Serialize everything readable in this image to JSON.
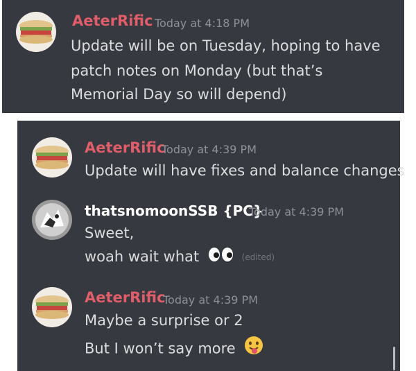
{
  "messages_top": {
    "msg1": {
      "username": "AeterRific",
      "timestamp": "Today at 4:18 PM",
      "lines": [
        "Update will be on Tuesday, hoping to have",
        "patch notes on Monday (but that’s",
        "Memorial Day so will depend)"
      ]
    }
  },
  "messages_bottom": {
    "msg2": {
      "username": "AeterRific",
      "timestamp": "Today at 4:39 PM",
      "lines": [
        "Update will have fixes and balance changes"
      ]
    },
    "msg3": {
      "username": "thatsnomoonSSB {PC}",
      "timestamp": "Today at 4:39 PM",
      "lines": [
        "Sweet,",
        "woah wait what"
      ],
      "edited_label": "(edited)",
      "emoji": "eyes"
    },
    "msg4": {
      "username": "AeterRific",
      "timestamp": "Today at 4:39 PM",
      "lines": [
        "Maybe a surprise or 2",
        "But I won’t say more"
      ],
      "emoji": "tongue-face"
    }
  },
  "colors": {
    "background": "#36393f",
    "username_red": "#e05d6a",
    "timestamp": "#8e9297",
    "text": "#dcddde"
  }
}
